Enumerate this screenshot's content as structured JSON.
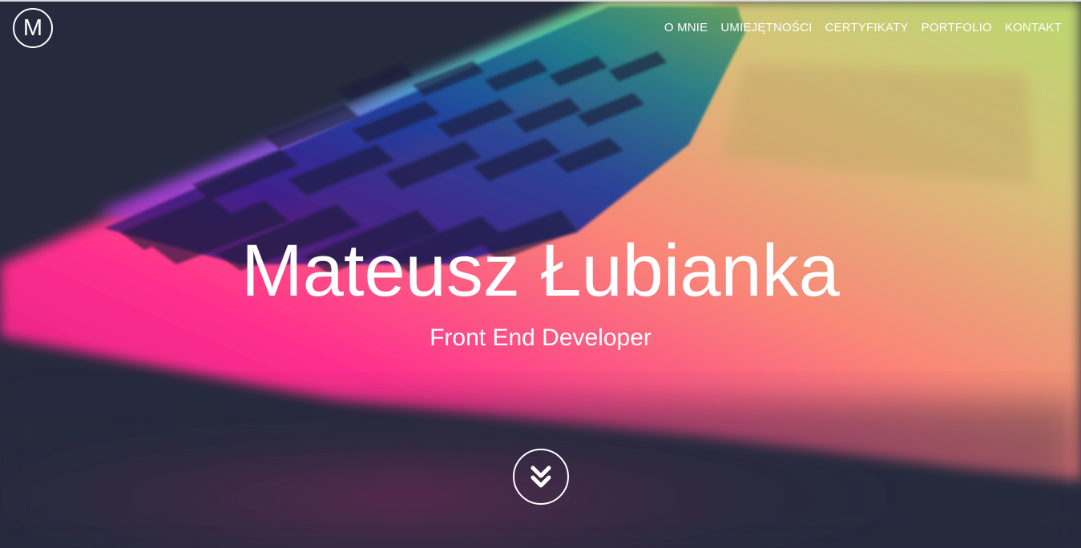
{
  "logo": {
    "letter": "M"
  },
  "nav": {
    "items": [
      {
        "label": "O MNIE"
      },
      {
        "label": "UMIEJĘTNOŚCI"
      },
      {
        "label": "CERTYFIKATY"
      },
      {
        "label": "PORTFOLIO"
      },
      {
        "label": "KONTAKT"
      }
    ]
  },
  "hero": {
    "name": "Mateusz Łubianka",
    "role": "Front End Developer",
    "scroll_icon": "double-chevron-down-icon",
    "background_icon": "keyboard-photo"
  },
  "colors": {
    "text": "#ffffff",
    "dark_bg": "#262a3d",
    "magenta": "#ff2f8e",
    "salmon": "#f98877",
    "lime": "#c7df6e",
    "cyan": "#18a8d8",
    "purple": "#7d3fe0"
  }
}
